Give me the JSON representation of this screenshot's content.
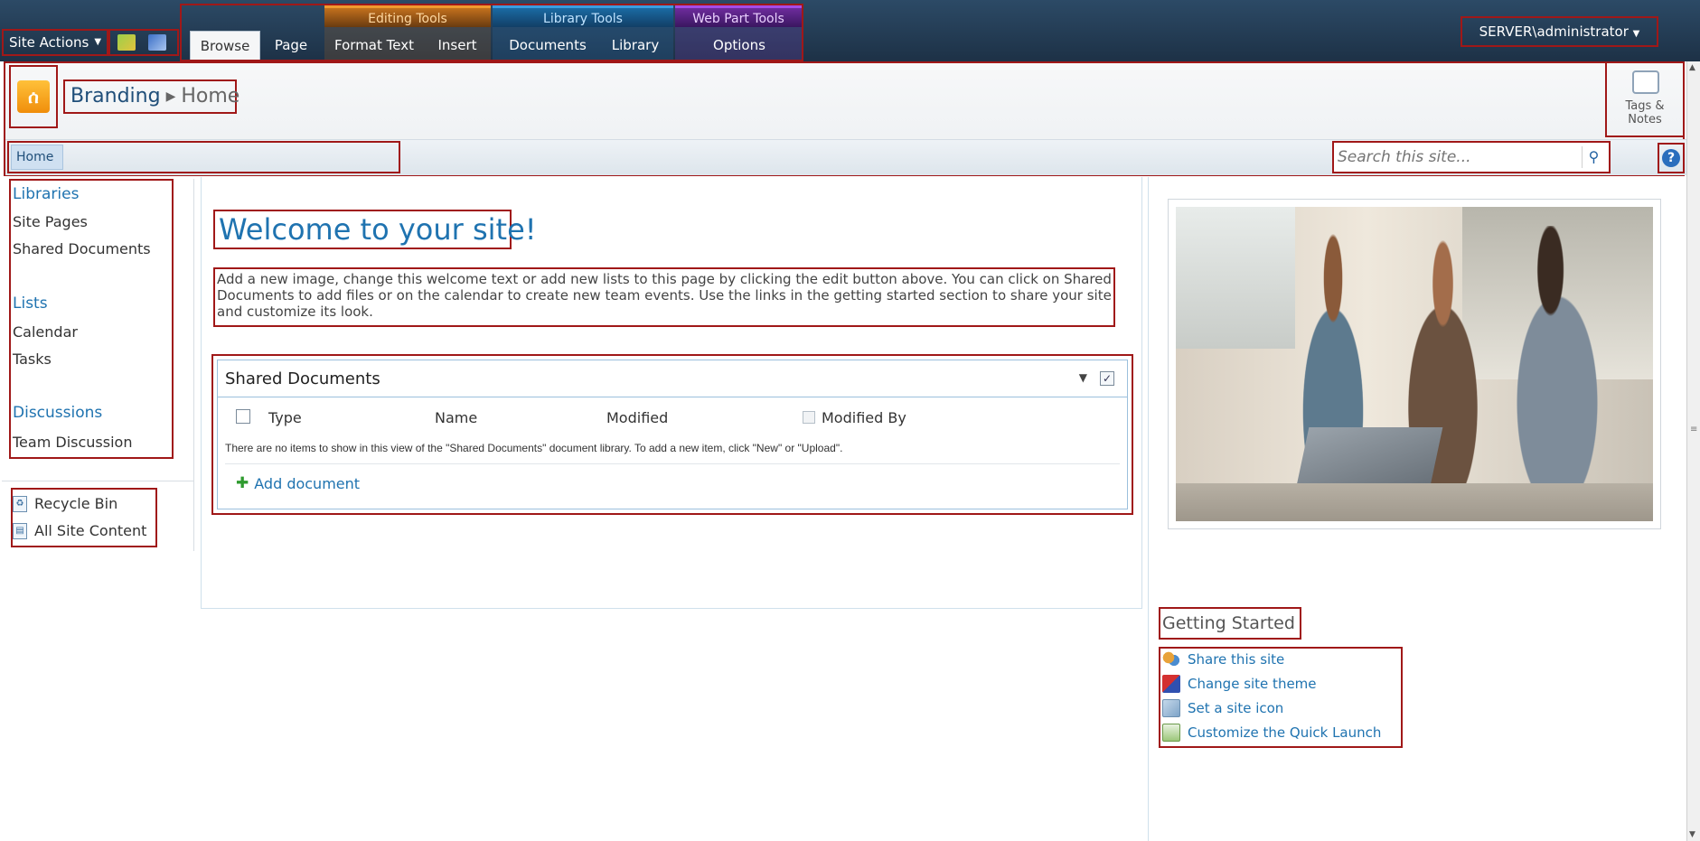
{
  "ribbon": {
    "site_actions": "Site Actions",
    "tabs": [
      "Browse",
      "Page",
      "Format Text",
      "Insert",
      "Documents",
      "Library",
      "Options"
    ],
    "context_groups": {
      "editing": "Editing Tools",
      "library": "Library Tools",
      "webpart": "Web Part Tools"
    },
    "user": "SERVER\\administrator"
  },
  "header": {
    "logo_glyph": "ሰ",
    "breadcrumb_site": "Branding",
    "breadcrumb_page": "Home",
    "tags_notes": "Tags &\nNotes",
    "top_nav_home": "Home",
    "search_placeholder": "Search this site...",
    "help": "?"
  },
  "quick_launch": {
    "libraries_heading": "Libraries",
    "libraries": [
      "Site Pages",
      "Shared Documents"
    ],
    "lists_heading": "Lists",
    "lists": [
      "Calendar",
      "Tasks"
    ],
    "discussions_heading": "Discussions",
    "discussions": [
      "Team Discussion"
    ],
    "recycle_bin": "Recycle Bin",
    "all_site_content": "All Site Content"
  },
  "main": {
    "welcome_title": "Welcome to your site!",
    "welcome_text": "Add a new image, change this welcome text or add new lists to this page by clicking the edit button above. You can click on Shared Documents to add files or on the calendar to create new team events. Use the links in the getting started section to share your site and customize its look.",
    "shared_docs": {
      "title": "Shared Documents",
      "columns": [
        "Type",
        "Name",
        "Modified",
        "Modified By"
      ],
      "empty_message": "There are no items to show in this view of the \"Shared Documents\" document library. To add a new item, click \"New\" or \"Upload\".",
      "add_document": "Add document"
    }
  },
  "right": {
    "getting_started": "Getting Started",
    "links": [
      "Share this site",
      "Change site theme",
      "Set a site icon",
      "Customize the Quick Launch"
    ]
  },
  "icons": {
    "logo": "team-site-icon",
    "search": "magnifier-icon",
    "help": "help-icon",
    "recycle": "recycle-bin-icon",
    "content": "site-content-icon"
  }
}
